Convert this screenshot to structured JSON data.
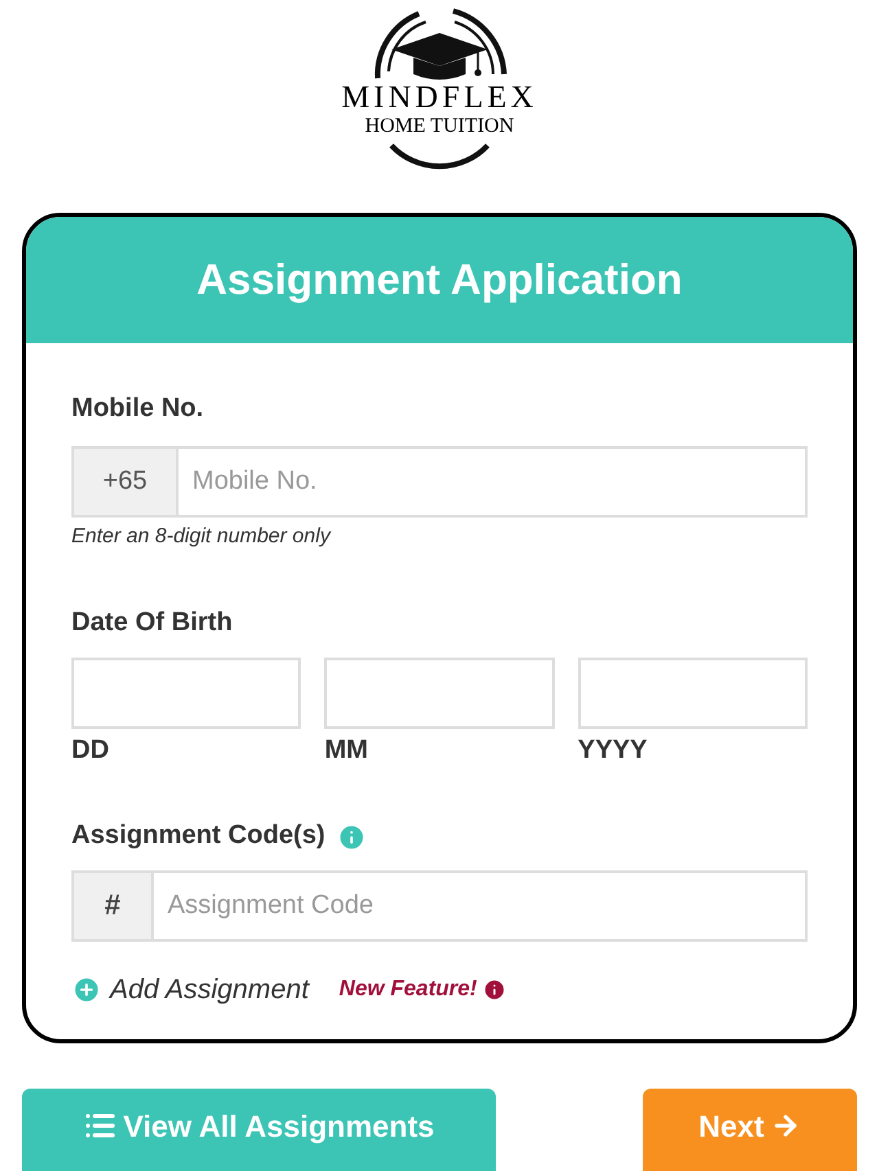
{
  "logo": {
    "name": "MINDFLEX",
    "tagline": "HOME TUITION"
  },
  "form": {
    "title": "Assignment Application",
    "mobile": {
      "label": "Mobile No.",
      "prefix": "+65",
      "placeholder": "Mobile No.",
      "hint": "Enter an 8-digit number only"
    },
    "dob": {
      "label": "Date Of Birth",
      "parts": [
        "DD",
        "MM",
        "YYYY"
      ]
    },
    "assignment": {
      "label": "Assignment Code(s)",
      "prefix": "#",
      "placeholder": "Assignment Code",
      "add": "Add Assignment",
      "badge": "New Feature!"
    }
  },
  "buttons": [
    {
      "kind": "list",
      "label": "View All Assignments"
    },
    {
      "kind": "next",
      "label": "Next"
    }
  ]
}
